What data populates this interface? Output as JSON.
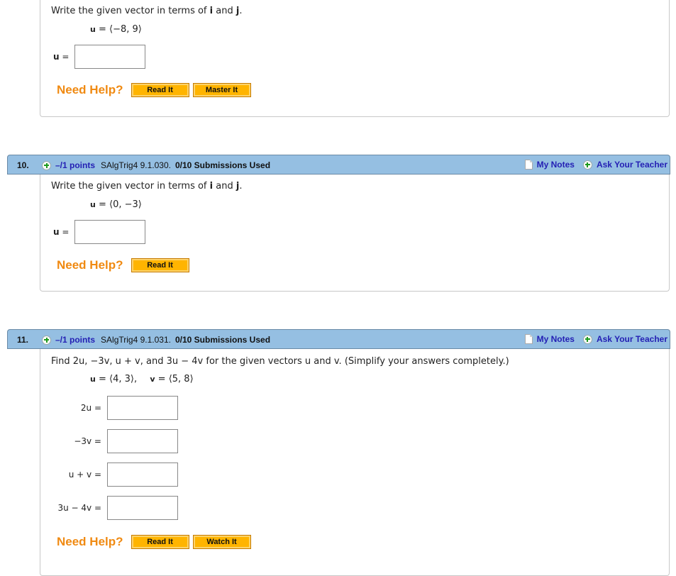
{
  "questions": [
    {
      "prompt_pre": "Write the given vector in terms of ",
      "prompt_i": "i",
      "prompt_and": " and ",
      "prompt_j": "j",
      "prompt_end": ".",
      "given_var": "u",
      "given_value": " = ⟨−8, 9⟩",
      "answers": [
        {
          "label_var": "u",
          "label_rest": " =",
          "value": ""
        }
      ],
      "help_label": "Need Help?",
      "help_buttons": [
        "Read It",
        "Master It"
      ]
    },
    {
      "number": "10.",
      "points": "–/1 points",
      "code": "SAlgTrig4 9.1.030.",
      "submissions": "0/10 Submissions Used",
      "my_notes": "My Notes",
      "ask_teacher": "Ask Your Teacher",
      "prompt_pre": "Write the given vector in terms of ",
      "prompt_i": "i",
      "prompt_and": " and ",
      "prompt_j": "j",
      "prompt_end": ".",
      "given_var": "u",
      "given_value": " = ⟨0, −3⟩",
      "answers": [
        {
          "label_var": "u",
          "label_rest": " =",
          "value": ""
        }
      ],
      "help_label": "Need Help?",
      "help_buttons": [
        "Read It"
      ]
    },
    {
      "number": "11.",
      "points": "–/1 points",
      "code": "SAlgTrig4 9.1.031.",
      "submissions": "0/10 Submissions Used",
      "my_notes": "My Notes",
      "ask_teacher": "Ask Your Teacher",
      "prompt": "Find 2u, −3v, u + v, and 3u − 4v for the given vectors u and v. (Simplify your answers completely.)",
      "given_u_var": "u",
      "given_u_value": " = ⟨4, 3⟩,",
      "given_v_var": "v",
      "given_v_value": " = ⟨5, 8⟩",
      "answers": [
        {
          "label": "2u  =",
          "value": ""
        },
        {
          "label": "−3v  =",
          "value": ""
        },
        {
          "label": "u + v  =",
          "value": ""
        },
        {
          "label": "3u − 4v  =",
          "value": ""
        }
      ],
      "help_label": "Need Help?",
      "help_buttons": [
        "Read It",
        "Watch It"
      ]
    }
  ]
}
